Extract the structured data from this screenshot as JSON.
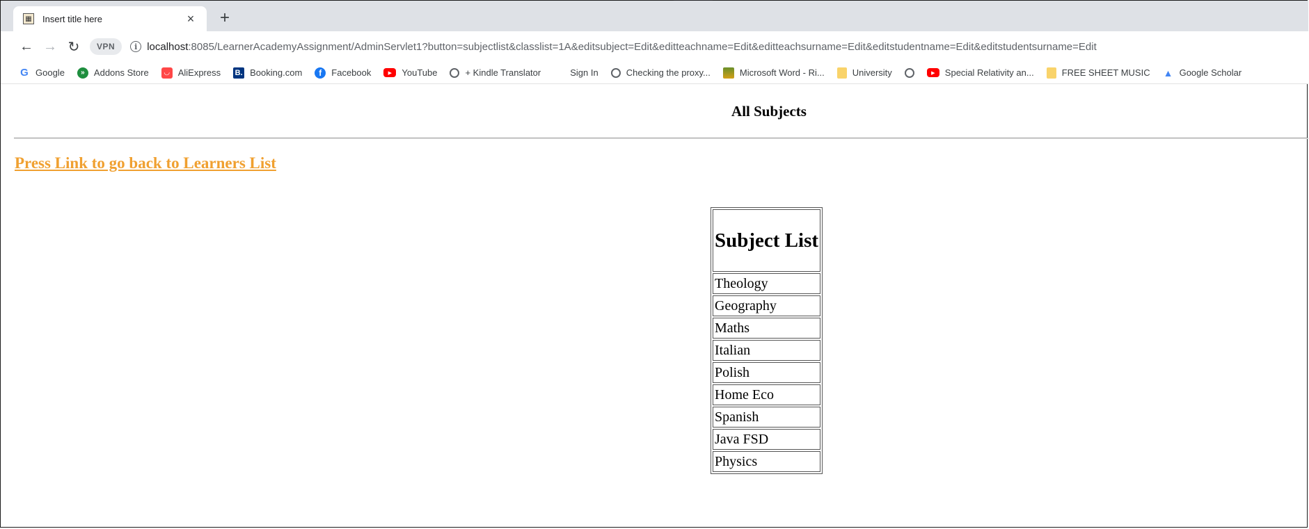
{
  "browser": {
    "tab_title": "Insert title here",
    "tab_close": "×",
    "new_tab": "+",
    "vpn_label": "VPN",
    "url_host": "localhost",
    "url_rest": ":8085/LearnerAcademyAssignment/AdminServlet1?button=subjectlist&classlist=1A&editsubject=Edit&editteachname=Edit&editteachsurname=Edit&editstudentname=Edit&editstudentsurname=Edit",
    "bookmarks": [
      {
        "label": "Google",
        "icon": "google-icon"
      },
      {
        "label": "Addons Store",
        "icon": "addons-store-icon"
      },
      {
        "label": "AliExpress",
        "icon": "aliexpress-icon"
      },
      {
        "label": "Booking.com",
        "icon": "booking-icon"
      },
      {
        "label": "Facebook",
        "icon": "facebook-icon"
      },
      {
        "label": "YouTube",
        "icon": "youtube-icon"
      },
      {
        "label": "+ Kindle Translator",
        "icon": "globe-icon"
      },
      {
        "label": "Sign In",
        "icon": "microsoft-icon"
      },
      {
        "label": "Checking the proxy...",
        "icon": "globe-icon"
      },
      {
        "label": "Microsoft Word - Ri...",
        "icon": "word-doc-icon"
      },
      {
        "label": "University",
        "icon": "folder-icon"
      },
      {
        "label": "",
        "icon": "globe-icon"
      },
      {
        "label": "Special Relativity an...",
        "icon": "youtube-icon"
      },
      {
        "label": "FREE SHEET MUSIC",
        "icon": "folder-icon"
      },
      {
        "label": "Google Scholar",
        "icon": "scholar-icon"
      }
    ]
  },
  "page": {
    "heading": "All Subjects",
    "back_link": "Press Link to go back to Learners List",
    "table_header": "Subject List",
    "subjects": [
      "Theology",
      "Geography",
      "Maths",
      "Italian",
      "Polish",
      "Home Eco",
      "Spanish",
      "Java FSD",
      "Physics"
    ]
  }
}
